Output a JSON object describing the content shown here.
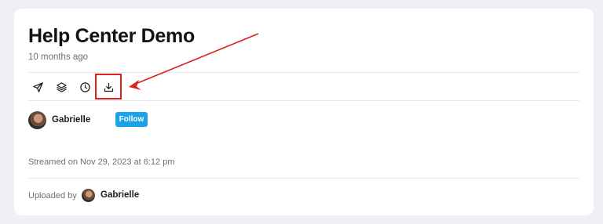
{
  "video": {
    "title": "Help Center Demo",
    "age": "10 months ago",
    "streamed": "Streamed on Nov 29, 2023 at 6:12 pm"
  },
  "actions": [
    {
      "name": "share",
      "icon": "send-icon"
    },
    {
      "name": "layers",
      "icon": "layers-icon"
    },
    {
      "name": "history",
      "icon": "clock-icon"
    },
    {
      "name": "download",
      "icon": "download-icon"
    }
  ],
  "author": {
    "name": "Gabrielle",
    "follow_label": "Follow"
  },
  "upload": {
    "label": "Uploaded by",
    "name": "Gabrielle"
  },
  "colors": {
    "accent": "#1aa3e8",
    "annotation": "#d8231f",
    "background": "#eff0f3",
    "card": "#ffffff"
  }
}
